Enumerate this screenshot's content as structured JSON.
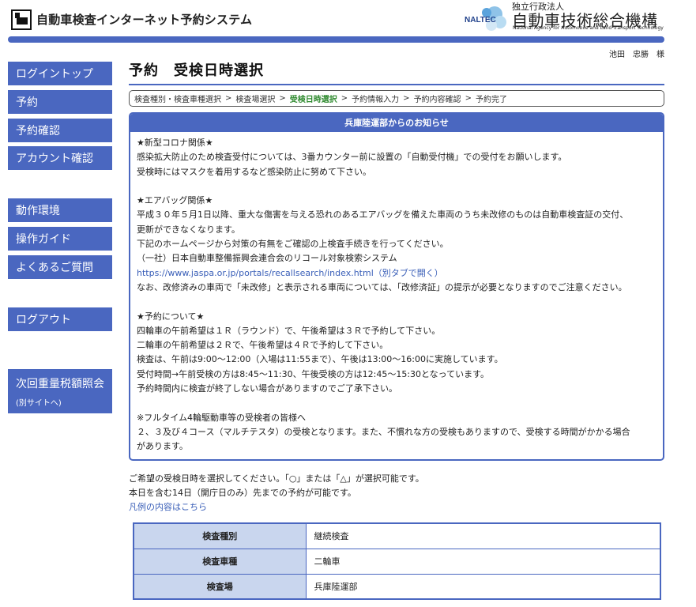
{
  "header": {
    "system_title": "自動車検査インターネット予約システム",
    "org_prefix": "独立行政法人",
    "org_name": "自動車技術総合機構",
    "org_english": "National Agency for Automobile and Land Transport Technology",
    "org_abbr": "NALTEC"
  },
  "user": {
    "name": "池田　忠勝　様"
  },
  "sidebar": {
    "items": [
      {
        "label": "ログイントップ"
      },
      {
        "label": "予約"
      },
      {
        "label": "予約確認"
      },
      {
        "label": "アカウント確認"
      },
      {
        "label": "動作環境"
      },
      {
        "label": "操作ガイド"
      },
      {
        "label": "よくあるご質問"
      },
      {
        "label": "ログアウト"
      },
      {
        "label": "次回重量税額照会",
        "sub": "(別サイトへ)"
      }
    ]
  },
  "page": {
    "title": "予約　受検日時選択"
  },
  "breadcrumb": {
    "steps": [
      "検査種別・検査車種選択",
      "検査場選択",
      "受検日時選択",
      "予約情報入力",
      "予約内容確認",
      "予約完了"
    ],
    "separator": ">"
  },
  "notice": {
    "heading": "兵庫陸運部からのお知らせ",
    "lines": [
      "★新型コロナ関係★",
      "感染拡大防止のため検査受付については、3番カウンター前に設置の「自動受付機」での受付をお願いします。",
      "受検時にはマスクを着用するなど感染防止に努めて下さい。",
      "",
      "★エアバッグ関係★",
      "平成３０年５月1日以降、重大な傷害を与える恐れのあるエアバッグを備えた車両のうち未改修のものは自動車検査証の交付、",
      "更新ができなくなります。",
      "下記のホームページから対策の有無をご確認の上検査手続きを行ってください。",
      "（一社）日本自動車整備振興会連合会のリコール対象検索システム",
      "https://www.jaspa.or.jp/portals/recallsearch/index.html（別タブで開く）",
      "なお、改修済みの車両で「未改修」と表示される車両については、「改修済証」の提示が必要となりますのでご注意ください。",
      "",
      "★予約について★",
      "四輪車の午前希望は１Ｒ（ラウンド）で、午後希望は３Ｒで予約して下さい。",
      "二輪車の午前希望は２Ｒで、午後希望は４Ｒで予約して下さい。",
      "検査は、午前は9:00～12:00（入場は11:55まで）、午後は13:00～16:00に実施しています。",
      "受付時間→午前受検の方は8:45～11:30、午後受検の方は12:45～15:30となっています。",
      "予約時間内に検査が終了しない場合がありますのでご了承下さい。",
      "",
      "※フルタイム4輪駆動車等の受検者の皆様へ",
      "２、３及び４コース（マルチテスタ）の受検となります。また、不慣れな方の受検もありますので、受検する時間がかかる場合",
      "があります。"
    ]
  },
  "guide": {
    "line1": "ご希望の受検日時を選択してください。「○」または「△」が選択可能です。",
    "line2": "本日を含む14日（開庁日のみ）先までの予約が可能です。",
    "legend_link": "凡例の内容はこちら"
  },
  "info_table": {
    "rows": [
      {
        "label": "検査種別",
        "value": "継続検査"
      },
      {
        "label": "検査車種",
        "value": "二輪車"
      },
      {
        "label": "検査場",
        "value": "兵庫陸運部"
      }
    ]
  },
  "colors": {
    "accent": "#4a67c0",
    "table_header_bg": "#c9d6ee",
    "link": "#3a5fb8",
    "current_step": "#2f8a2f"
  }
}
